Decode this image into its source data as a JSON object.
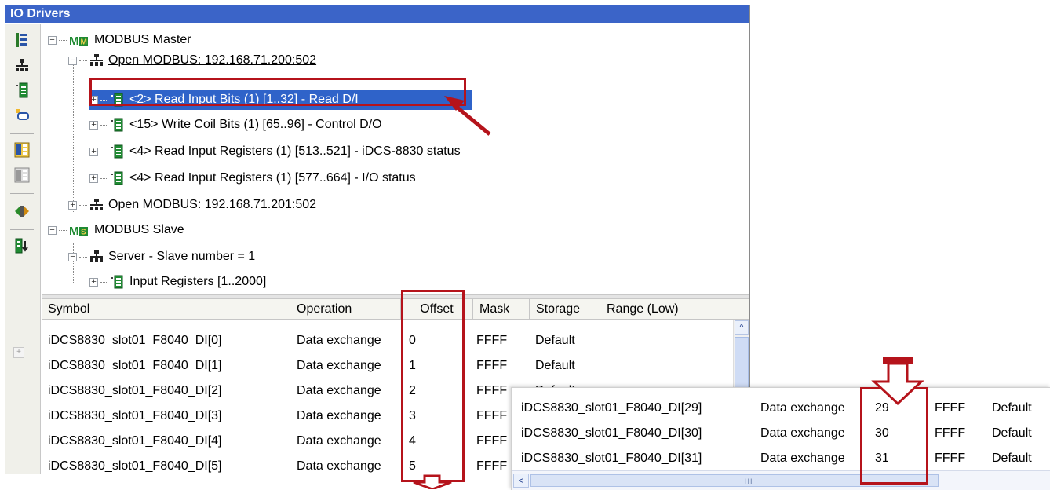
{
  "panel": {
    "title": "IO Drivers"
  },
  "toolbar": {
    "icons": [
      "tree-view-icon",
      "network-icon",
      "block-icon",
      "connect-icon",
      "import-icon",
      "export-icon",
      "exchange-icon",
      "sort-icon"
    ]
  },
  "tree": {
    "nodes": [
      {
        "label": "MODBUS Master",
        "expander": "−",
        "icon": "modbus-master-icon"
      },
      {
        "label": "Open MODBUS: 192.168.71.200:502",
        "expander": "−",
        "icon": "network-icon"
      },
      {
        "label": "<2> Read Input Bits (1) [1..32] - Read D/I",
        "expander": "+",
        "icon": "block-icon",
        "selected": true
      },
      {
        "label": "<15> Write Coil Bits (1) [65..96] - Control D/O",
        "expander": "+",
        "icon": "block-icon"
      },
      {
        "label": "<4> Read Input Registers (1) [513..521] - iDCS-8830 status",
        "expander": "+",
        "icon": "block-icon"
      },
      {
        "label": "<4> Read Input Registers (1) [577..664] - I/O status",
        "expander": "+",
        "icon": "block-icon"
      },
      {
        "label": "Open MODBUS: 192.168.71.201:502",
        "expander": "+",
        "icon": "network-icon"
      },
      {
        "label": "MODBUS Slave",
        "expander": "−",
        "icon": "modbus-slave-icon"
      },
      {
        "label": "Server - Slave number = 1",
        "expander": "−",
        "icon": "network-icon"
      },
      {
        "label": "Input Registers [1..2000]",
        "expander": "+",
        "icon": "block-icon"
      }
    ]
  },
  "grid": {
    "columns": [
      "Symbol",
      "Operation",
      "Offset",
      "Mask",
      "Storage",
      "Range (Low)"
    ],
    "rows": [
      [
        "iDCS8830_slot01_F8040_DI[0]",
        "Data exchange",
        "0",
        "FFFF",
        "Default"
      ],
      [
        "iDCS8830_slot01_F8040_DI[1]",
        "Data exchange",
        "1",
        "FFFF",
        "Default"
      ],
      [
        "iDCS8830_slot01_F8040_DI[2]",
        "Data exchange",
        "2",
        "FFFF",
        "Default"
      ],
      [
        "iDCS8830_slot01_F8040_DI[3]",
        "Data exchange",
        "3",
        "FFFF",
        ""
      ],
      [
        "iDCS8830_slot01_F8040_DI[4]",
        "Data exchange",
        "4",
        "FFFF",
        ""
      ],
      [
        "iDCS8830_slot01_F8040_DI[5]",
        "Data exchange",
        "5",
        "FFFF",
        ""
      ]
    ],
    "scroll_up_glyph": "^"
  },
  "inset": {
    "rows": [
      [
        "iDCS8830_slot01_F8040_DI[29]",
        "Data exchange",
        "29",
        "FFFF",
        "Default"
      ],
      [
        "iDCS8830_slot01_F8040_DI[30]",
        "Data exchange",
        "30",
        "FFFF",
        "Default"
      ],
      [
        "iDCS8830_slot01_F8040_DI[31]",
        "Data exchange",
        "31",
        "FFFF",
        "Default"
      ]
    ],
    "scroll_left_glyph": "<",
    "thumb_grip": "III"
  },
  "colors": {
    "highlight": "#b5131b",
    "selection": "#2f63c9",
    "title": "#3b64c8"
  }
}
